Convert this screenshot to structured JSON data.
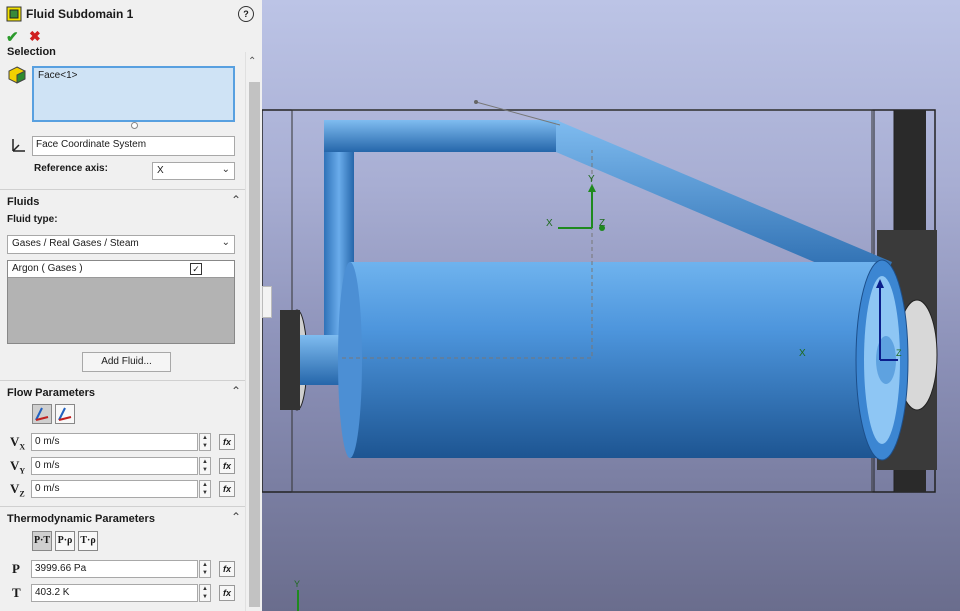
{
  "panel": {
    "title": "Fluid Subdomain 1",
    "help": "?",
    "ok": "✔",
    "cancel": "✖",
    "selection": {
      "heading": "Selection",
      "face": "Face<1>",
      "coord_system": "Face Coordinate System",
      "ref_axis_label": "Reference axis:",
      "ref_axis_value": "X"
    },
    "fluids": {
      "heading": "Fluids",
      "fluid_type_label": "Fluid type:",
      "fluid_type_value": "Gases / Real Gases / Steam",
      "list_item": "Argon ( Gases )",
      "add_button": "Add Fluid..."
    },
    "flow": {
      "heading": "Flow Parameters",
      "vx": "0 m/s",
      "vy": "0 m/s",
      "vz": "0 m/s",
      "sym_v": "V",
      "sub_x": "X",
      "sub_y": "Y",
      "sub_z": "Z"
    },
    "thermo": {
      "heading": "Thermodynamic Parameters",
      "btn_pt": "P·T",
      "btn_pp": "P·ρ",
      "btn_tp": "T·ρ",
      "p_label": "P",
      "t_label": "T",
      "p_value": "3999.66 Pa",
      "t_value": "403.2 K"
    },
    "fx": "fx"
  },
  "viewport": {
    "axis_x": "X",
    "axis_y": "Y",
    "axis_z": "Z",
    "accent": "#3a86d4"
  }
}
